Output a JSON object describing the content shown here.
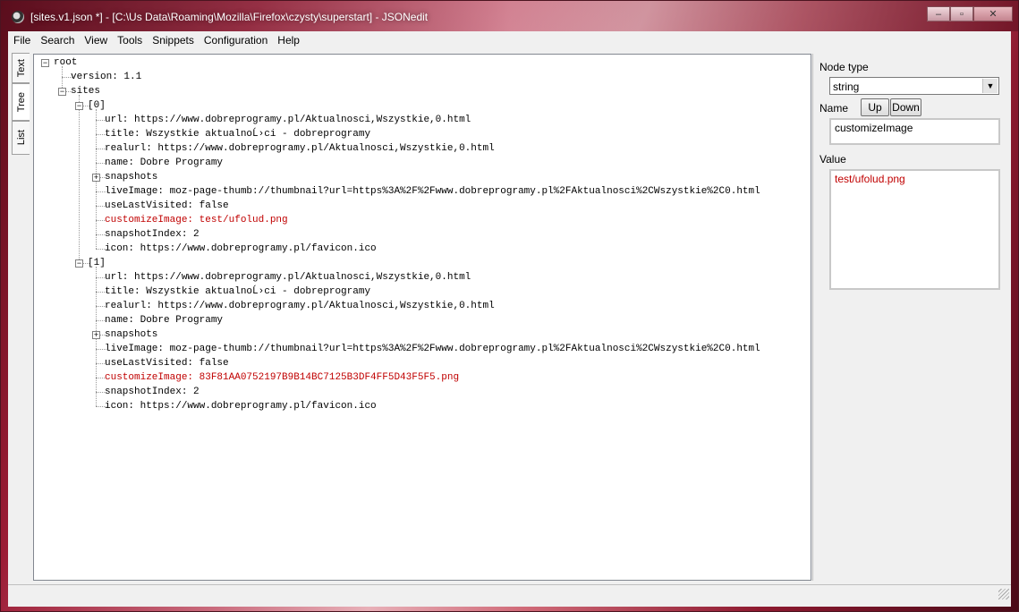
{
  "window": {
    "title": "[sites.v1.json *] - [C:\\Us              Data\\Roaming\\Mozilla\\Firefox\\czysty\\superstart] - JSONedit",
    "minimize": "–",
    "maximize": "▫",
    "close": "✕"
  },
  "menu": [
    "File",
    "Search",
    "View",
    "Tools",
    "Snippets",
    "Configuration",
    "Help"
  ],
  "tabs": [
    "Text",
    "Tree",
    "List"
  ],
  "tree": [
    {
      "text": "root"
    },
    {
      "text": "version: 1.1"
    },
    {
      "text": "sites"
    },
    {
      "text": "[0]"
    },
    {
      "text": "url: https://www.dobreprogramy.pl/Aktualnosci,Wszystkie,0.html"
    },
    {
      "text": "title: Wszystkie aktualnoĹ›ci - dobreprogramy"
    },
    {
      "text": "realurl: https://www.dobreprogramy.pl/Aktualnosci,Wszystkie,0.html"
    },
    {
      "text": "name: Dobre Programy"
    },
    {
      "text": "snapshots"
    },
    {
      "text": "liveImage: moz-page-thumb://thumbnail?url=https%3A%2F%2Fwww.dobreprogramy.pl%2FAktualnosci%2CWszystkie%2C0.html"
    },
    {
      "text": "useLastVisited: false"
    },
    {
      "text": "customizeImage: test/ufolud.png"
    },
    {
      "text": "snapshotIndex: 2"
    },
    {
      "text": "icon: https://www.dobreprogramy.pl/favicon.ico"
    },
    {
      "text": "[1]"
    },
    {
      "text": "url: https://www.dobreprogramy.pl/Aktualnosci,Wszystkie,0.html"
    },
    {
      "text": "title: Wszystkie aktualnoĹ›ci - dobreprogramy"
    },
    {
      "text": "realurl: https://www.dobreprogramy.pl/Aktualnosci,Wszystkie,0.html"
    },
    {
      "text": "name: Dobre Programy"
    },
    {
      "text": "snapshots"
    },
    {
      "text": "liveImage: moz-page-thumb://thumbnail?url=https%3A%2F%2Fwww.dobreprogramy.pl%2FAktualnosci%2CWszystkie%2C0.html"
    },
    {
      "text": "useLastVisited: false"
    },
    {
      "text": "customizeImage: 83F81AA0752197B9B14BC7125B3DF4FF5D43F5F5.png"
    },
    {
      "text": "snapshotIndex: 2"
    },
    {
      "text": "icon: https://www.dobreprogramy.pl/favicon.ico"
    }
  ],
  "expander_signs": {
    "expanded": "−",
    "collapsed": "+"
  },
  "colors": {
    "modified_text": "#c00000"
  },
  "props": {
    "node_type_label": "Node type",
    "node_type_value": "string",
    "name_label": "Name",
    "up_label": "Up",
    "down_label": "Down",
    "name_value": "customizeImage",
    "value_label": "Value",
    "value_value": "test/ufolud.png"
  }
}
